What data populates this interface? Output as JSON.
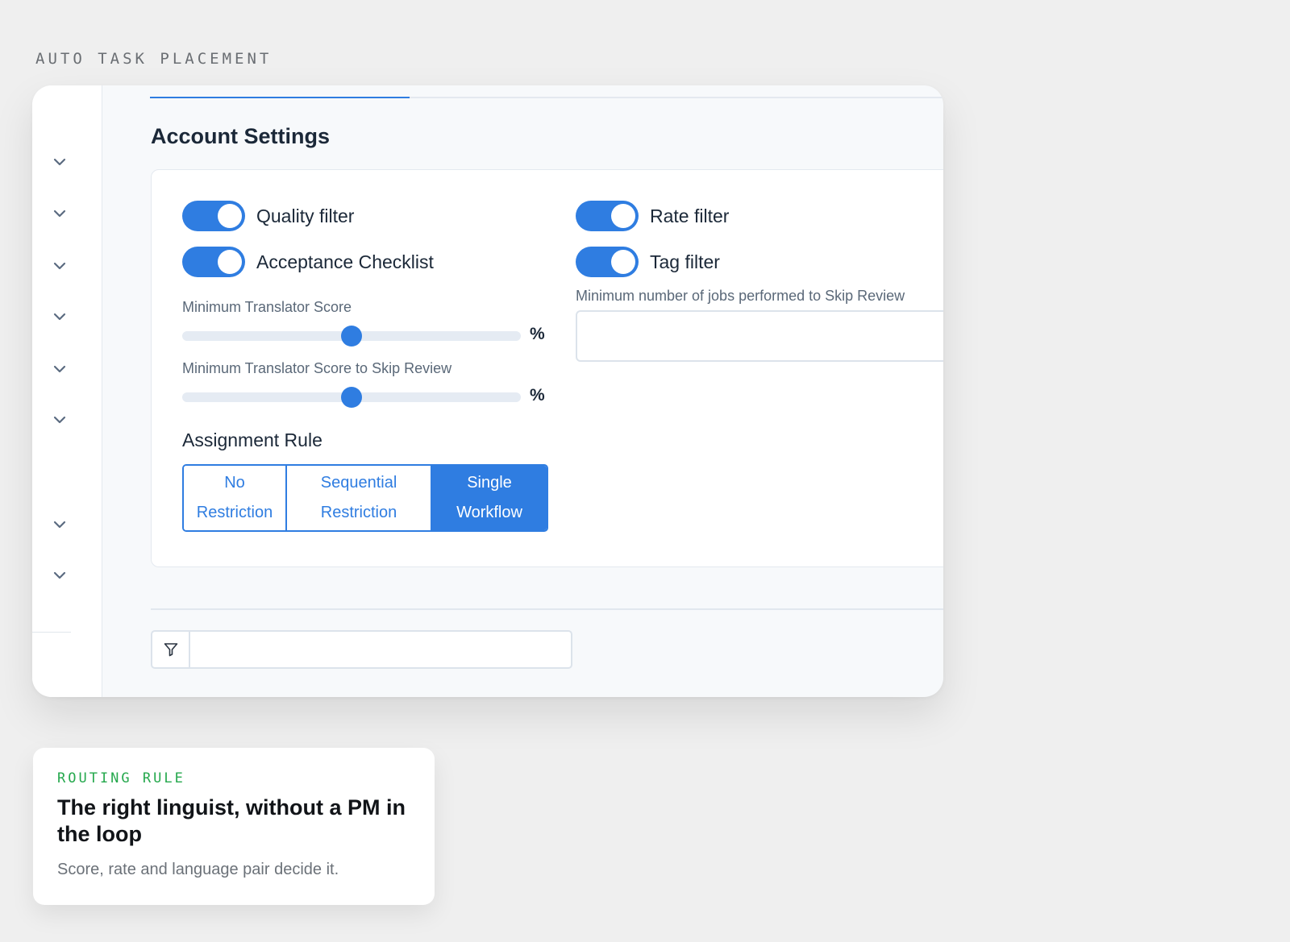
{
  "eyebrow": "AUTO TASK PLACEMENT",
  "colors": {
    "accent": "#2f7de1",
    "page_bg": "#efefef",
    "routing_green": "#25a84d"
  },
  "sidebar": {
    "icons": [
      "chevron-down-icon",
      "chevron-down-icon",
      "chevron-down-icon",
      "chevron-down-icon",
      "chevron-down-icon",
      "chevron-down-icon",
      "chevron-down-icon",
      "chevron-down-icon"
    ]
  },
  "main": {
    "title": "Account Settings",
    "toggles": {
      "quality_filter": {
        "label": "Quality filter",
        "on": true
      },
      "acceptance_checklist": {
        "label": "Acceptance Checklist",
        "on": true
      },
      "rate_filter": {
        "label": "Rate filter",
        "on": true
      },
      "tag_filter": {
        "label": "Tag filter",
        "on": true
      }
    },
    "min_score": {
      "label": "Minimum Translator Score",
      "unit": "%",
      "level": 0.5
    },
    "min_score_skip": {
      "label": "Minimum Translator Score to Skip Review",
      "unit": "%",
      "level": 0.5
    },
    "min_jobs": {
      "label": "Minimum number of jobs performed to Skip Review",
      "value": ""
    },
    "assignment": {
      "label": "Assignment Rule",
      "options": [
        {
          "line1": "No",
          "line2": "Restriction"
        },
        {
          "line1": "Sequential",
          "line2": "Restriction"
        },
        {
          "line1": "Single",
          "line2": "Workflow"
        }
      ],
      "selected": "Single Workflow"
    },
    "filter": {
      "icon": "filter-icon",
      "value": ""
    }
  },
  "callout": {
    "eyebrow": "ROUTING RULE",
    "title": "The right linguist, without a PM in the loop",
    "subtitle": "Score, rate and language pair decide it."
  }
}
